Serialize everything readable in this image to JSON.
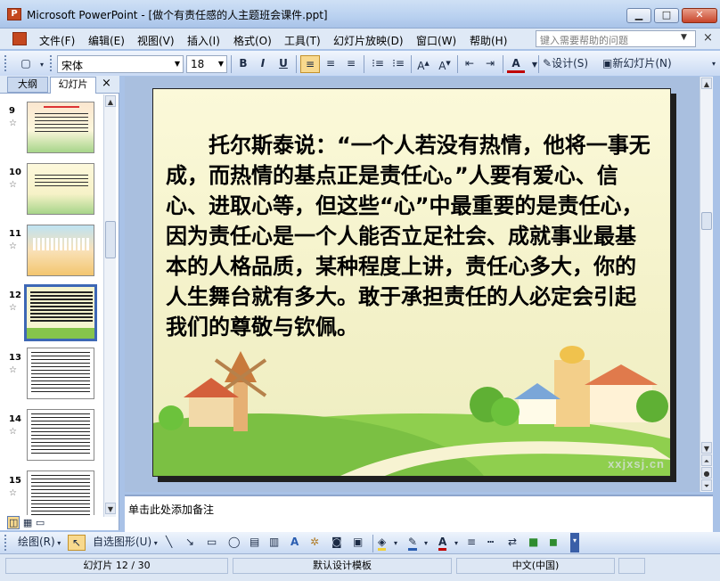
{
  "window": {
    "app_icon": "P",
    "title": "Microsoft PowerPoint - [做个有责任感的人主题班会课件.ppt]",
    "buttons": {
      "minimize": "▁",
      "maximize": "□",
      "close": "✕"
    }
  },
  "menubar": {
    "items": [
      "文件(F)",
      "编辑(E)",
      "视图(V)",
      "插入(I)",
      "格式(O)",
      "工具(T)",
      "幻灯片放映(D)",
      "窗口(W)",
      "帮助(H)"
    ],
    "help_placeholder": "键入需要帮助的问题",
    "close_doc": "×"
  },
  "toolbar": {
    "font_name": "宋体",
    "font_size": "18",
    "bold": "B",
    "italic": "I",
    "underline": "U",
    "design_label": "设计(S)",
    "new_slide_label": "新幻灯片(N)"
  },
  "panel": {
    "tab_outline": "大纲",
    "tab_slides": "幻灯片",
    "close": "×",
    "thumbnails": [
      {
        "num": "9",
        "selected": false
      },
      {
        "num": "10",
        "selected": false
      },
      {
        "num": "11",
        "selected": false
      },
      {
        "num": "12",
        "selected": true
      },
      {
        "num": "13",
        "selected": false
      },
      {
        "num": "14",
        "selected": false
      },
      {
        "num": "15",
        "selected": false
      }
    ],
    "star": "☆"
  },
  "slide": {
    "body": "托尔斯泰说：“一个人若没有热情，他将一事无成，而热情的基点正是责任心。”人要有爱心、信心、进取心等，但这些“心”中最重要的是责任心，因为责任心是一个人能否立足社会、成就事业最基本的人格品质，某种程度上讲，责任心多大，你的人生舞台就有多大。敢于承担责任的人必定会引起我们的尊敬与钦佩。",
    "watermark": "xxjxsj.cn"
  },
  "notes": {
    "placeholder": "单击此处添加备注"
  },
  "drawbar": {
    "draw_label": "绘图(R)",
    "autoshapes_label": "自选图形(U)"
  },
  "statusbar": {
    "slide_pos": "幻灯片 12 / 30",
    "template": "默认设计模板",
    "language": "中文(中国)"
  },
  "colors": {
    "titlebar": "#b9d1f0",
    "toolbar": "#dfe9f6",
    "workspace": "#a9bfdf",
    "slide_bg": "#f6f4cf",
    "selected_border": "#3d67b5"
  }
}
